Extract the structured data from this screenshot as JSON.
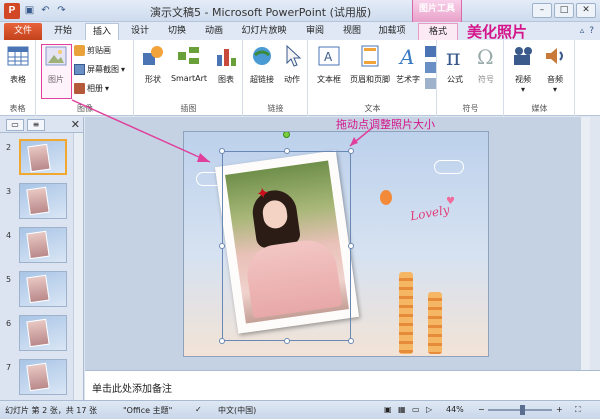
{
  "window": {
    "title": "演示文稿5 - Microsoft PowerPoint (试用版)",
    "tool_context": "图片工具"
  },
  "qat": {
    "app_icon": "P",
    "save": "▣",
    "undo": "↶",
    "redo": "↷"
  },
  "tabs": [
    "文件",
    "开始",
    "插入",
    "设计",
    "切换",
    "动画",
    "幻灯片放映",
    "审阅",
    "视图",
    "加载项",
    "格式"
  ],
  "active_tab": "插入",
  "annotation_top": "美化照片",
  "annotation_slide": "拖动点调整照片大小",
  "ribbon": {
    "table": {
      "label": "表格",
      "group": "表格"
    },
    "image": {
      "picture": "图片",
      "clipart": "剪贴画",
      "screenshot": "屏幕截图",
      "album": "相册",
      "group": "图像"
    },
    "illustrations": {
      "shapes": "形状",
      "smartart": "SmartArt",
      "chart": "图表",
      "group": "插图"
    },
    "links": {
      "hyperlink": "超链接",
      "action": "动作",
      "group": "链接"
    },
    "text": {
      "textbox": "文本框",
      "header": "页眉和页脚",
      "wordart": "艺术字",
      "group": "文本"
    },
    "symbols": {
      "formula": "公式",
      "symbol": "符号",
      "group": "符号"
    },
    "media": {
      "video": "视频",
      "audio": "音频",
      "group": "媒体"
    }
  },
  "slides": [
    "2",
    "3",
    "4",
    "5",
    "6",
    "7"
  ],
  "slide_text": {
    "lovely": "Lovely"
  },
  "notes_placeholder": "单击此处添加备注",
  "status": {
    "slide_info": "幻灯片 第 2 张，共 17 张",
    "theme": "\"Office 主题\"",
    "language": "中文(中国)",
    "zoom": "44%"
  },
  "colors": {
    "accent_pink": "#d5158b",
    "file_tab": "#d24726"
  }
}
